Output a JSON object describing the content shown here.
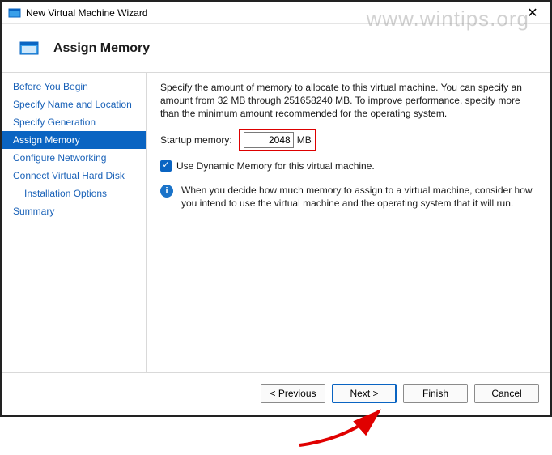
{
  "window": {
    "title": "New Virtual Machine Wizard"
  },
  "watermark": "www.wintips.org",
  "page": {
    "heading": "Assign Memory"
  },
  "sidebar": {
    "steps": [
      "Before You Begin",
      "Specify Name and Location",
      "Specify Generation",
      "Assign Memory",
      "Configure Networking",
      "Connect Virtual Hard Disk",
      "Installation Options",
      "Summary"
    ],
    "active_index": 3,
    "sub_indexes": [
      6
    ]
  },
  "content": {
    "intro": "Specify the amount of memory to allocate to this virtual machine. You can specify an amount from 32 MB through 251658240 MB. To improve performance, specify more than the minimum amount recommended for the operating system.",
    "startup_label": "Startup memory:",
    "startup_value": "2048",
    "startup_unit": "MB",
    "dynamic_label": "Use Dynamic Memory for this virtual machine.",
    "dynamic_checked": true,
    "info_text": "When you decide how much memory to assign to a virtual machine, consider how you intend to use the virtual machine and the operating system that it will run."
  },
  "footer": {
    "previous": "< Previous",
    "next": "Next >",
    "finish": "Finish",
    "cancel": "Cancel"
  }
}
